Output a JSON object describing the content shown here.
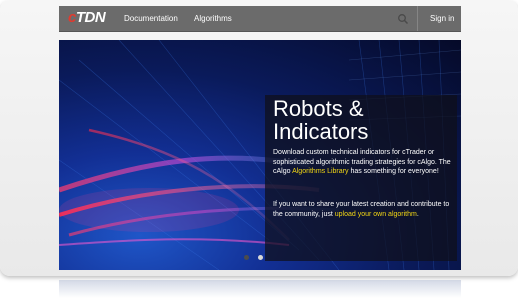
{
  "navbar": {
    "logo_prefix": "c",
    "logo_rest": "TDN",
    "links": [
      {
        "label": "Documentation"
      },
      {
        "label": "Algorithms"
      }
    ],
    "search_icon": "search-icon",
    "signin_label": "Sign in"
  },
  "hero": {
    "title": "Robots & Indicators",
    "p1_before": "Download custom technical indicators for cTrader or sophisticated algorithmic trading strategies for cAlgo. The cAlgo ",
    "p1_link": "Algorithms Library",
    "p1_after": " has something for everyone!",
    "p2_before": "If you want to share your latest creation and contribute to the community, just ",
    "p2_link": "upload your own algorithm",
    "p2_after": ".",
    "slides_total": 2,
    "active_slide": 2
  },
  "colors": {
    "navbar_bg": "#6b6b6b",
    "logo_accent": "#e03a2f",
    "highlight": "#f2d614"
  }
}
